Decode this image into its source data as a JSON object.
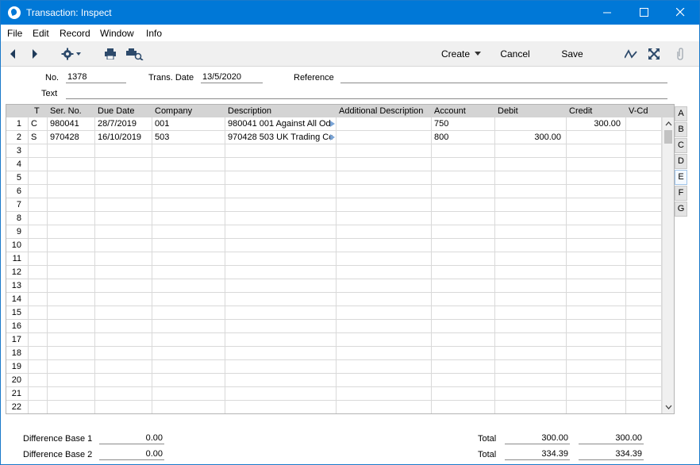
{
  "window": {
    "title": "Transaction: Inspect"
  },
  "menu": {
    "items": [
      "File",
      "Edit",
      "Record",
      "Window",
      "Info"
    ]
  },
  "toolbar": {
    "create_label": "Create",
    "cancel_label": "Cancel",
    "save_label": "Save"
  },
  "header": {
    "no_label": "No.",
    "no_value": "1378",
    "trans_date_label": "Trans. Date",
    "trans_date_value": "13/5/2020",
    "reference_label": "Reference",
    "reference_value": "",
    "text_label": "Text",
    "text_value": ""
  },
  "grid": {
    "columns": [
      "",
      "T",
      "Ser. No.",
      "Due Date",
      "Company",
      "Description",
      "Additional Description",
      "Account",
      "Debit",
      "Credit",
      "V-Cd"
    ],
    "rows": [
      {
        "n": "1",
        "t": "C",
        "ser": "980041",
        "due": "28/7/2019",
        "company": "001",
        "desc": "980041 001 Against All Od",
        "add": "",
        "account": "750",
        "debit": "",
        "credit": "300.00",
        "vcd": ""
      },
      {
        "n": "2",
        "t": "S",
        "ser": "970428",
        "due": "16/10/2019",
        "company": "503",
        "desc": "970428 503 UK Trading Cc",
        "add": "",
        "account": "800",
        "debit": "300.00",
        "credit": "",
        "vcd": ""
      },
      {
        "n": "3"
      },
      {
        "n": "4"
      },
      {
        "n": "5"
      },
      {
        "n": "6"
      },
      {
        "n": "7"
      },
      {
        "n": "8"
      },
      {
        "n": "9"
      },
      {
        "n": "10"
      },
      {
        "n": "11"
      },
      {
        "n": "12"
      },
      {
        "n": "13"
      },
      {
        "n": "14"
      },
      {
        "n": "15"
      },
      {
        "n": "16"
      },
      {
        "n": "17"
      },
      {
        "n": "18"
      },
      {
        "n": "19"
      },
      {
        "n": "20"
      },
      {
        "n": "21"
      },
      {
        "n": "22"
      }
    ]
  },
  "tabs": [
    "A",
    "B",
    "C",
    "D",
    "E",
    "F",
    "G"
  ],
  "active_tab": "E",
  "footer": {
    "diff_base1_label": "Difference Base 1",
    "diff_base1_value": "0.00",
    "diff_base2_label": "Difference Base 2",
    "diff_base2_value": "0.00",
    "total_label": "Total",
    "total1_debit": "300.00",
    "total1_credit": "300.00",
    "total2_debit": "334.39",
    "total2_credit": "334.39"
  },
  "colors": {
    "titlebar": "#0078d7",
    "header_row": "#d4d4d4",
    "toolbar": "#f0f0f0"
  }
}
